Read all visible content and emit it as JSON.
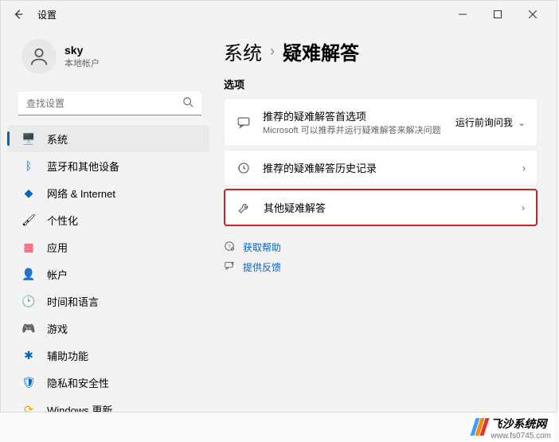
{
  "window": {
    "title": "设置"
  },
  "user": {
    "name": "sky",
    "type": "本地帐户"
  },
  "search": {
    "placeholder": "查找设置"
  },
  "nav": [
    {
      "label": "系统",
      "icon": "🖥️",
      "iconName": "system-icon",
      "active": true
    },
    {
      "label": "蓝牙和其他设备",
      "icon": "ᛒ",
      "iconName": "bluetooth-icon",
      "iconColor": "#0067c0"
    },
    {
      "label": "网络 & Internet",
      "icon": "◆",
      "iconName": "network-icon",
      "iconColor": "#0067c0"
    },
    {
      "label": "个性化",
      "icon": "🖌",
      "iconName": "personalize-icon"
    },
    {
      "label": "应用",
      "icon": "▦",
      "iconName": "apps-icon",
      "iconColor": "#d45"
    },
    {
      "label": "帐户",
      "icon": "👤",
      "iconName": "accounts-icon",
      "iconColor": "#c76a2b"
    },
    {
      "label": "时间和语言",
      "icon": "🕑",
      "iconName": "time-icon"
    },
    {
      "label": "游戏",
      "icon": "🎮",
      "iconName": "gaming-icon"
    },
    {
      "label": "辅助功能",
      "icon": "✱",
      "iconName": "accessibility-icon",
      "iconColor": "#0067c0"
    },
    {
      "label": "隐私和安全性",
      "icon": "🛡",
      "iconName": "privacy-icon",
      "iconColor": "#0067c0"
    },
    {
      "label": "Windows 更新",
      "icon": "⟳",
      "iconName": "update-icon",
      "iconColor": "#f0a400"
    }
  ],
  "breadcrumb": {
    "parent": "系统",
    "sep": "›",
    "current": "疑难解答"
  },
  "section_label": "选项",
  "cards": {
    "recommend": {
      "title": "推荐的疑难解答首选项",
      "sub": "Microsoft 可以推荐并运行疑难解答来解决问题",
      "action": "运行前询问我"
    },
    "history": {
      "title": "推荐的疑难解答历史记录"
    },
    "other": {
      "title": "其他疑难解答"
    }
  },
  "links": {
    "help": "获取帮助",
    "feedback": "提供反馈"
  },
  "watermark": {
    "name": "飞沙系统网",
    "url": "www.fs0745.com"
  }
}
